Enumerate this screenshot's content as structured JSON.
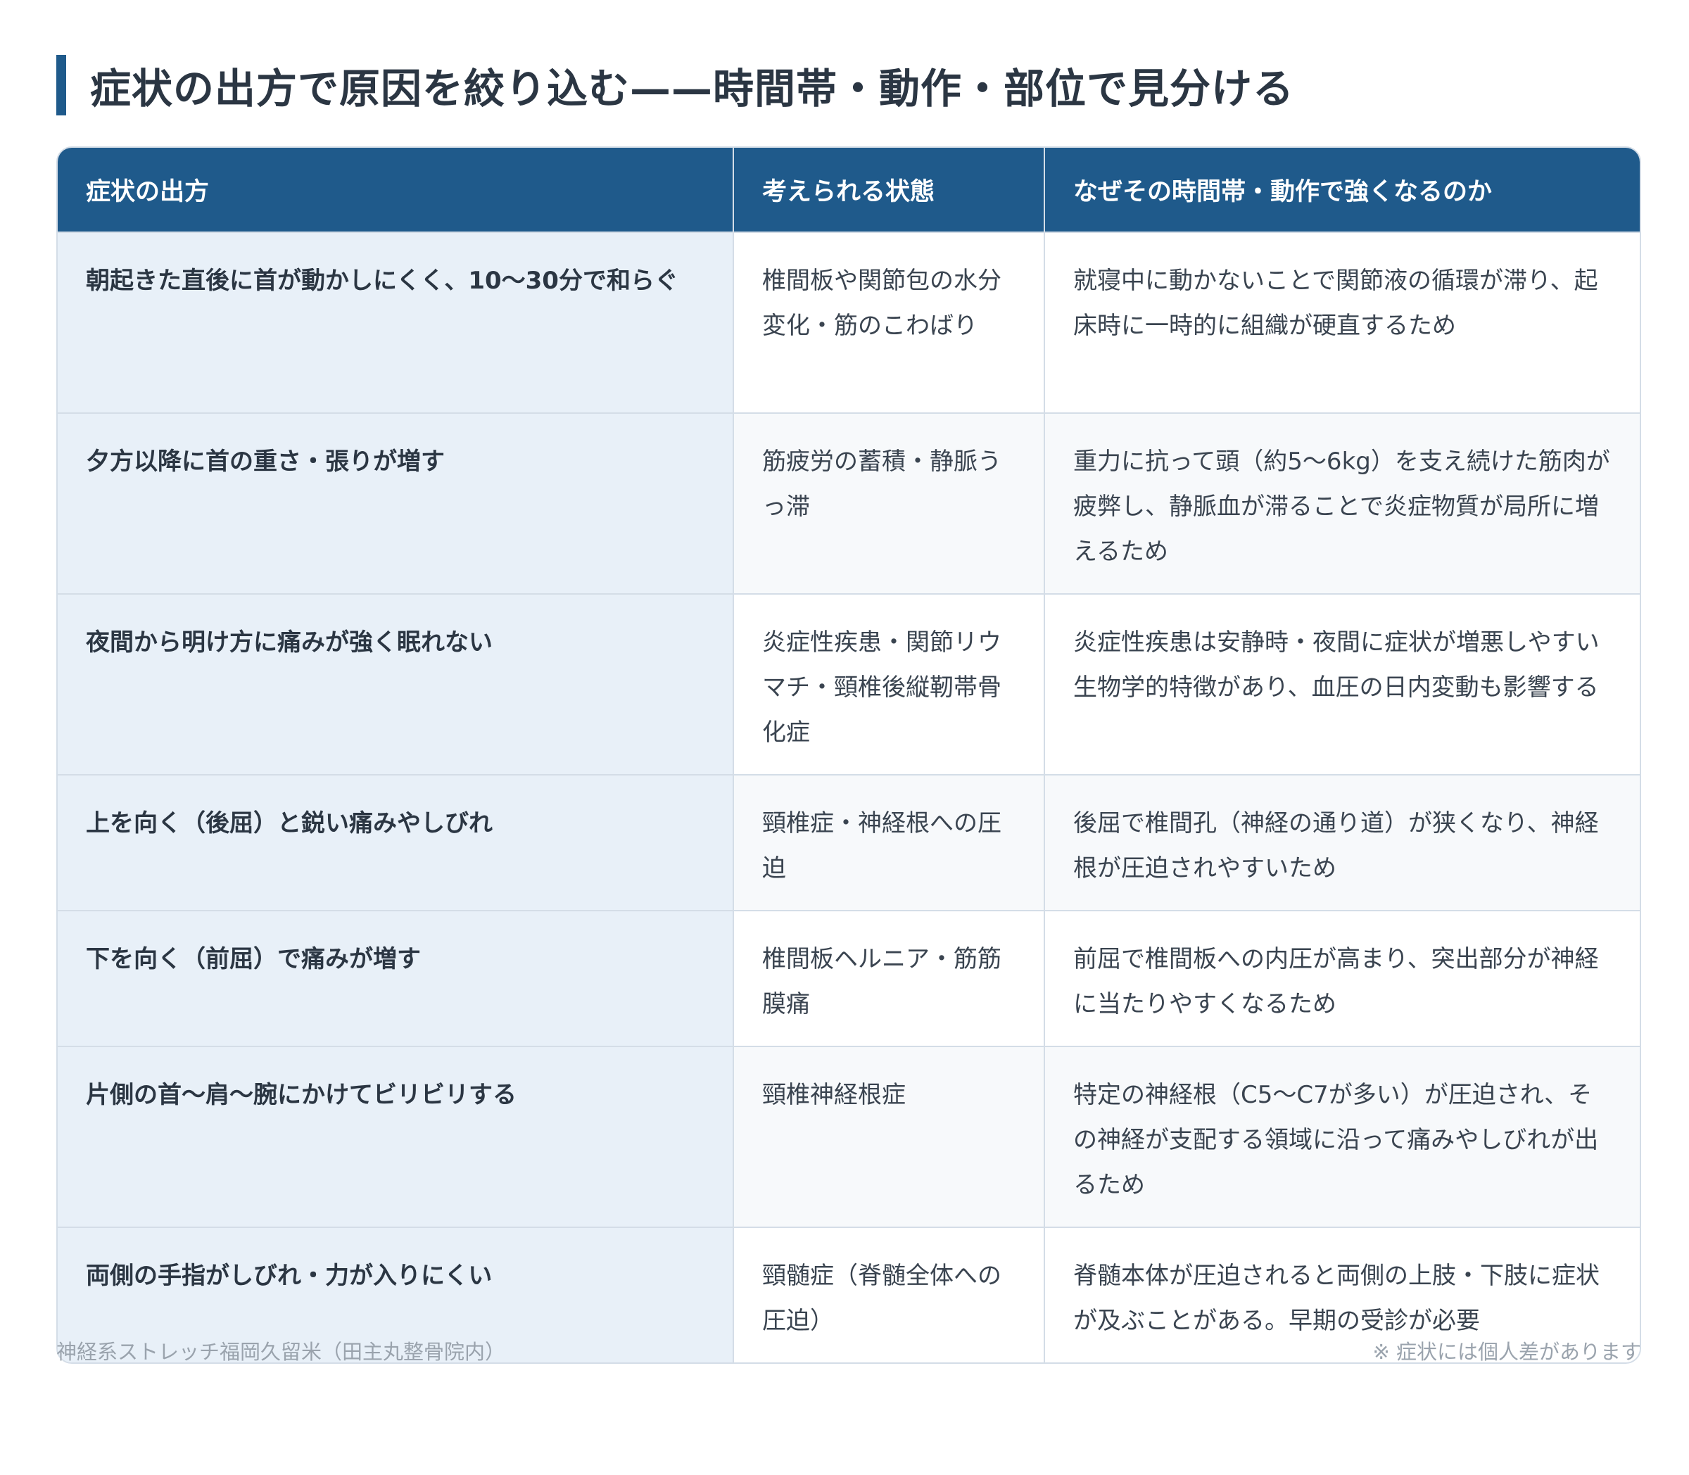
{
  "title": "症状の出方で原因を絞り込む——時間帯・動作・部位で見分ける",
  "colors": {
    "accent": "#1f5a8b",
    "header_text": "#ffffff",
    "first_column_bg": "#e8f0f8",
    "border": "#d4dde7",
    "footer_text": "#9aa3ad"
  },
  "table": {
    "headers": [
      "症状の出方",
      "考えられる状態",
      "なぜその時間帯・動作で強くなるのか"
    ],
    "rows": [
      {
        "symptom": "朝起きた直後に首が動かしにくく、10〜30分で和らぐ",
        "condition": "椎間板や関節包の水分変化・筋のこわばり",
        "reason": "就寝中に動かないことで関節液の循環が滞り、起床時に一時的に組織が硬直するため"
      },
      {
        "symptom": "夕方以降に首の重さ・張りが増す",
        "condition": "筋疲労の蓄積・静脈うっ滞",
        "reason": "重力に抗って頭（約5〜6kg）を支え続けた筋肉が疲弊し、静脈血が滞ることで炎症物質が局所に増えるため"
      },
      {
        "symptom": "夜間から明け方に痛みが強く眠れない",
        "condition": "炎症性疾患・関節リウマチ・頸椎後縦靭帯骨化症",
        "reason": "炎症性疾患は安静時・夜間に症状が増悪しやすい生物学的特徴があり、血圧の日内変動も影響する"
      },
      {
        "symptom": "上を向く（後屈）と鋭い痛みやしびれ",
        "condition": "頸椎症・神経根への圧迫",
        "reason": "後屈で椎間孔（神経の通り道）が狭くなり、神経根が圧迫されやすいため"
      },
      {
        "symptom": "下を向く（前屈）で痛みが増す",
        "condition": "椎間板ヘルニア・筋筋膜痛",
        "reason": "前屈で椎間板への内圧が高まり、突出部分が神経に当たりやすくなるため"
      },
      {
        "symptom": "片側の首〜肩〜腕にかけてビリビリする",
        "condition": "頸椎神経根症",
        "reason": "特定の神経根（C5〜C7が多い）が圧迫され、その神経が支配する領域に沿って痛みやしびれが出るため"
      },
      {
        "symptom": "両側の手指がしびれ・力が入りにくい",
        "condition": "頸髄症（脊髄全体への圧迫）",
        "reason": "脊髄本体が圧迫されると両側の上肢・下肢に症状が及ぶことがある。早期の受診が必要"
      }
    ]
  },
  "footer": {
    "source": "神経系ストレッチ福岡久留米（田主丸整骨院内）",
    "note": "※ 症状には個人差があります"
  }
}
